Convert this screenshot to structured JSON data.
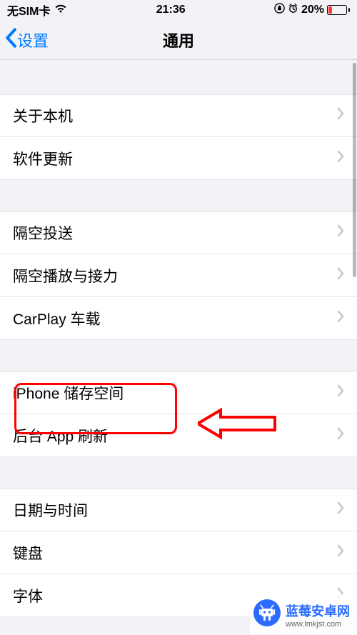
{
  "status": {
    "carrier": "无SIM卡",
    "time": "21:36",
    "battery_pct": "20%"
  },
  "nav": {
    "back_label": "设置",
    "title": "通用"
  },
  "rows": {
    "about": "关于本机",
    "software_update": "软件更新",
    "airdrop": "隔空投送",
    "airplay_handoff": "隔空播放与接力",
    "carplay": "CarPlay 车载",
    "iphone_storage": "iPhone 储存空间",
    "background_refresh": "后台 App 刷新",
    "date_time": "日期与时间",
    "keyboard": "键盘",
    "fonts": "字体"
  },
  "watermark": {
    "title": "蓝莓安卓网",
    "url": "www.lmkjst.com"
  }
}
